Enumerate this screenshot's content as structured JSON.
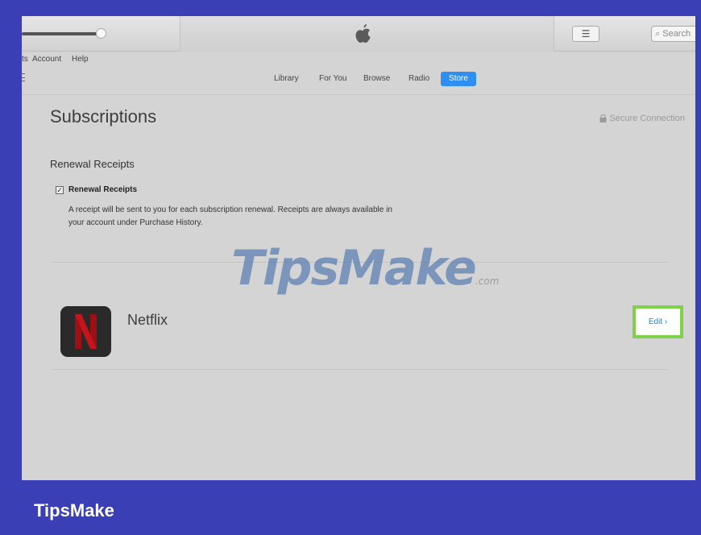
{
  "window": {
    "search_placeholder": "Search",
    "list_icon": "list-icon",
    "apple_icon": "apple-logo-icon"
  },
  "menubar": {
    "partial_item": "ts",
    "account": "Account",
    "help": "Help"
  },
  "toolbar": {
    "tabs": [
      "Library",
      "For You",
      "Browse",
      "Radio",
      "Store"
    ],
    "active_tab": "Store"
  },
  "page": {
    "title": "Subscriptions",
    "secure_connection": "Secure Connection",
    "section_heading": "Renewal Receipts",
    "checkbox_label": "Renewal Receipts",
    "checkbox_checked": true,
    "description": "A receipt will be sent to you for each subscription renewal. Receipts are always available in your account under Purchase History."
  },
  "subscription": {
    "app_name": "Netflix",
    "edit_label": "Edit ›"
  },
  "watermark": {
    "main": "TipsMake",
    "suffix": ".com"
  },
  "footer": {
    "brand": "TipsMake"
  },
  "colors": {
    "frame": "#3a3fb5",
    "store_tab": "#2f8ff0",
    "highlight": "#7ed24a",
    "netflix_red": "#c4141c"
  }
}
